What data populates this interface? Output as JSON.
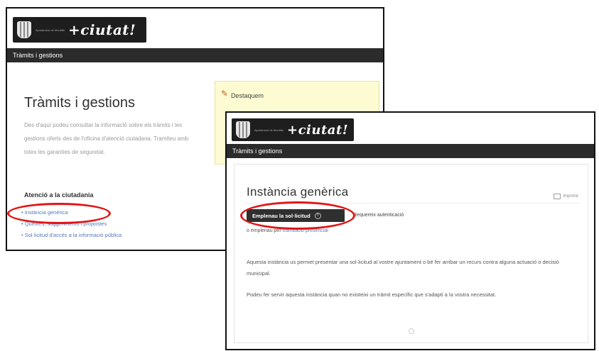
{
  "back_window": {
    "logo": {
      "small_text": "Ajuntament de Montilla",
      "script": "+ciutat!"
    },
    "nav_label": "Tràmits i gestions",
    "title": "Tràmits i gestions",
    "description": "Des d'aquí podeu consultar la informació sobre els tràmits i les gestions oferts des de l'oficina d'atenció ciutadana. Tramiteu amb totes les garanties de seguretat.",
    "section_heading": "Atenció a la ciutadania",
    "links": [
      "Instància genèrica",
      "Queixes, suggeriments i propostes",
      "Sol·licitud d'accés a la informació pública"
    ],
    "highlight": {
      "label": "Destaquem"
    }
  },
  "front_window": {
    "logo": {
      "small_text": "Ajuntament de Montilla",
      "script": "+ciutat!"
    },
    "nav_label": "Tràmits i gestions",
    "title": "Instància genèrica",
    "print_label": "Imprimir",
    "start_button": "Emplenau la sol·licitud",
    "auth_text": "Requereix autenticació",
    "or_prefix": "o emplenau per",
    "or_link": "tramitació presencial",
    "paragraph1": "Aquesta instància us permet presentar una sol·licitud al vostre ajuntament o bé fer arribar un recurs contra alguna actuació o decisió municipal.",
    "paragraph2": "Podeu fer servir aquesta instància quan no existeixi un tràmit específic que s'adapti a la vostra necessitat."
  },
  "annotations": {
    "color": "#e01616"
  }
}
